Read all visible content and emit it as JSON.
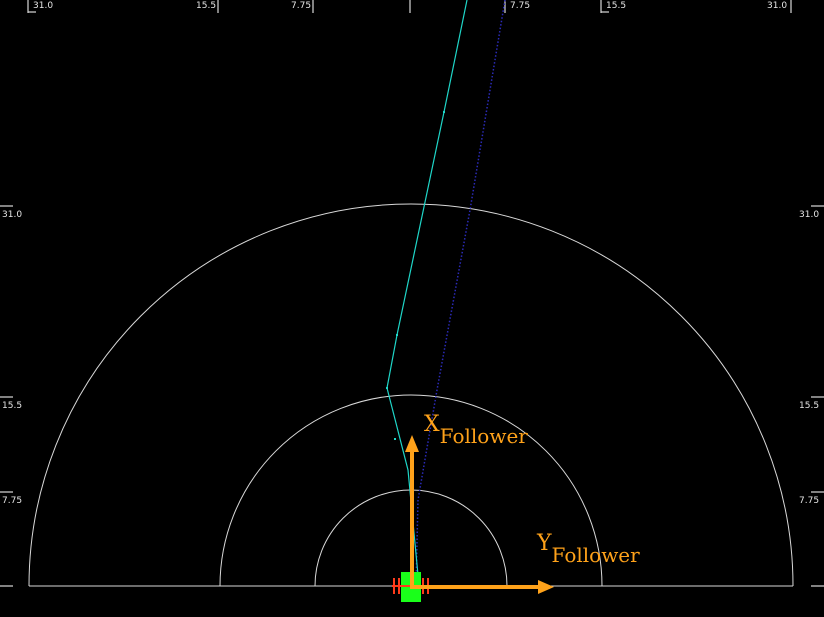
{
  "ruler": {
    "top_labels": [
      "31.0",
      "15.5",
      "7.75",
      "7.75",
      "15.5",
      "31.0"
    ],
    "left_labels": [
      "31.0",
      "15.5",
      "7.75"
    ],
    "right_labels": [
      "31.0",
      "15.5",
      "7.75"
    ]
  },
  "follower_frame": {
    "x_axis": {
      "letter": "X",
      "subscript": "Follower"
    },
    "y_axis": {
      "letter": "Y",
      "subscript": "Follower"
    }
  },
  "colors": {
    "background": "#000000",
    "range_rings": "#d9d9d9",
    "leader_path": "#1fd6c8",
    "predicted_path": "#2b2bb8",
    "axis_arrows": "#ffa21a",
    "vehicle": "#1aff1a",
    "vehicle_markers": "#ff3b1a"
  },
  "icons": {
    "vehicle": "green-vehicle-marker",
    "x_arrow": "up-arrow",
    "y_arrow": "right-arrow"
  }
}
